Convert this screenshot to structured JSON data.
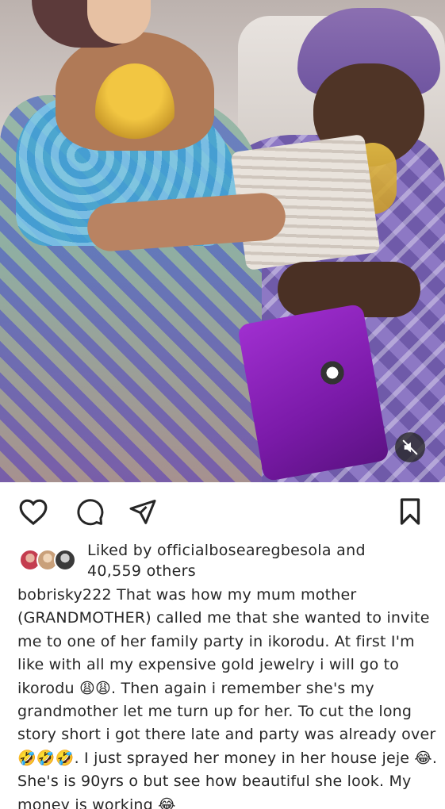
{
  "post": {
    "media": {
      "alt_icon": "photo",
      "mute_icon": "speaker-muted-icon"
    },
    "actions": {
      "like_icon": "heart-icon",
      "comment_icon": "comment-icon",
      "share_icon": "send-icon",
      "save_icon": "bookmark-icon"
    },
    "likes": {
      "prefix": "Liked by ",
      "username": "officialbosearegbesola",
      "connector": " and",
      "count": "40,559 others"
    },
    "caption": {
      "username": "bobrisky222",
      "text": " That was how my mum mother (GRANDMOTHER) called me that she wanted to invite me to one of her family party in ikorodu. At first I'm like with all my expensive gold jewelry i will go to ikorodu 😩😩. Then again i remember she's my grandmother let me turn up for her. To cut the long story short i got there late and party was already over 🤣🤣🤣. I just sprayed her money in her house jeje 😂. She's is 90yrs o but see how beautiful she look. My money is working 😂"
    },
    "colors": {
      "text": "#262626",
      "background": "#ffffff",
      "mute_bg": "#262626"
    }
  }
}
